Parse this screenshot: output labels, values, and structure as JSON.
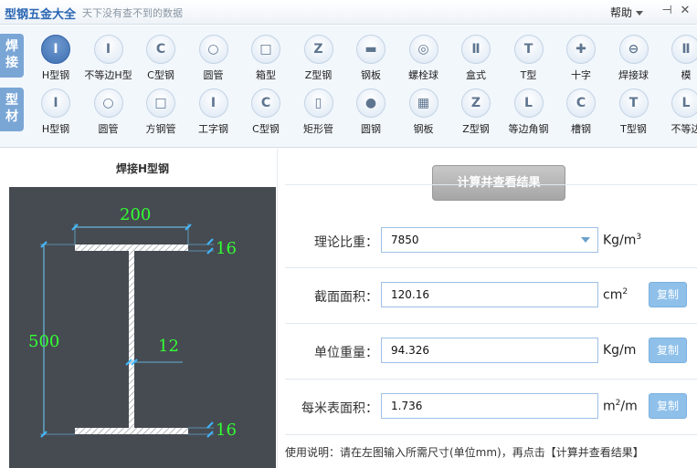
{
  "app": {
    "title": "型钢五金大全",
    "subtitle": "天下没有查不到的数据",
    "help_label": "帮助",
    "pin_glyph": "⊣",
    "close_glyph": "✕"
  },
  "toolbar": {
    "group1_tag": "焊接",
    "group2_tag": "型材",
    "row1": [
      {
        "label": "H型钢",
        "icon": "h-beam-icon",
        "glyph": "I",
        "active": true
      },
      {
        "label": "不等边H型",
        "icon": "unequal-h-icon",
        "glyph": "I"
      },
      {
        "label": "C型钢",
        "icon": "c-channel-icon",
        "glyph": "C"
      },
      {
        "label": "圆管",
        "icon": "round-tube-icon",
        "glyph": "○"
      },
      {
        "label": "箱型",
        "icon": "box-section-icon",
        "glyph": "□"
      },
      {
        "label": "Z型钢",
        "icon": "z-section-icon",
        "glyph": "Z"
      },
      {
        "label": "钢板",
        "icon": "steel-plate-icon",
        "glyph": "▬"
      },
      {
        "label": "螺栓球",
        "icon": "bolt-ball-icon",
        "glyph": "◎"
      },
      {
        "label": "盒式",
        "icon": "box-type-icon",
        "glyph": "Ⅱ"
      },
      {
        "label": "T型",
        "icon": "t-section-icon",
        "glyph": "T"
      },
      {
        "label": "十字",
        "icon": "cross-section-icon",
        "glyph": "✚"
      },
      {
        "label": "焊接球",
        "icon": "welded-ball-icon",
        "glyph": "⊖"
      },
      {
        "label": "模",
        "icon": "mold-icon",
        "glyph": "Ⅱ"
      }
    ],
    "row2": [
      {
        "label": "H型钢",
        "icon": "h-beam-icon",
        "glyph": "I"
      },
      {
        "label": "圆管",
        "icon": "round-tube-icon",
        "glyph": "○"
      },
      {
        "label": "方钢管",
        "icon": "square-tube-icon",
        "glyph": "□"
      },
      {
        "label": "工字钢",
        "icon": "i-beam-icon",
        "glyph": "I"
      },
      {
        "label": "C型钢",
        "icon": "c-channel-icon",
        "glyph": "C"
      },
      {
        "label": "矩形管",
        "icon": "rect-tube-icon",
        "glyph": "▯"
      },
      {
        "label": "圆钢",
        "icon": "round-bar-icon",
        "glyph": "●"
      },
      {
        "label": "钢板",
        "icon": "steel-plate-icon",
        "glyph": "▦"
      },
      {
        "label": "Z型钢",
        "icon": "z-section-icon",
        "glyph": "Z"
      },
      {
        "label": "等边角钢",
        "icon": "equal-angle-icon",
        "glyph": "L"
      },
      {
        "label": "槽钢",
        "icon": "channel-icon",
        "glyph": "C"
      },
      {
        "label": "T型钢",
        "icon": "t-section-icon",
        "glyph": "T"
      },
      {
        "label": "不等边",
        "icon": "unequal-angle-icon",
        "glyph": "L"
      }
    ]
  },
  "drawing": {
    "title": "焊接H型钢",
    "width": "200",
    "height": "500",
    "web_thickness": "12",
    "top_flange": "16",
    "bottom_flange": "16"
  },
  "form": {
    "calc_button": "计算并查看结果",
    "density_label": "理论比重：",
    "density_value": "7850",
    "density_unit": "Kg/m",
    "density_unit_sup": "3",
    "area_label": "截面面积：",
    "area_value": "120.16",
    "area_unit": "cm",
    "area_unit_sup": "2",
    "unit_weight_label": "单位重量：",
    "unit_weight_value": "94.326",
    "unit_weight_unit": "Kg/m",
    "surface_label": "每米表面积：",
    "surface_value": "1.736",
    "surface_unit_pre": "m",
    "surface_unit_sup": "2",
    "surface_unit_post": "/m",
    "copy_label": "复制"
  },
  "usage_text": "使用说明：请在左图输入所需尺寸(单位mm)，再点击【计算并查看结果】"
}
